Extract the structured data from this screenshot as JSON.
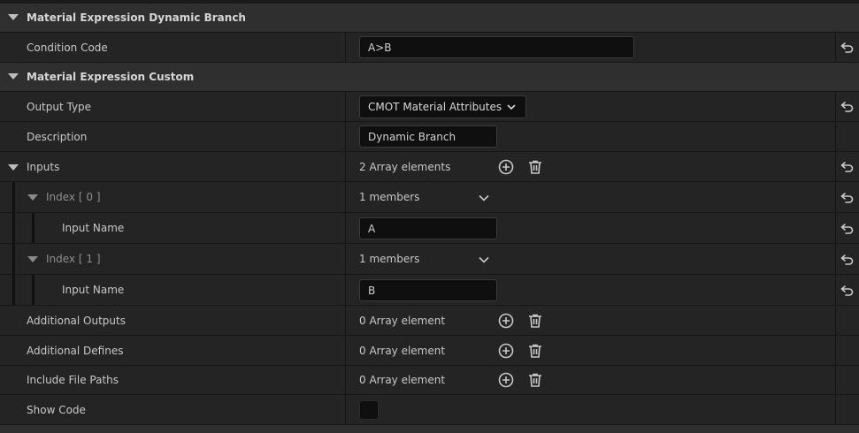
{
  "sections": {
    "dynamic_branch": {
      "title": "Material Expression Dynamic Branch"
    },
    "custom": {
      "title": "Material Expression Custom"
    }
  },
  "condition_code": {
    "label": "Condition Code",
    "value": "A>B"
  },
  "output_type": {
    "label": "Output Type",
    "value": "CMOT Material Attributes"
  },
  "description": {
    "label": "Description",
    "value": "Dynamic Branch"
  },
  "inputs": {
    "label": "Inputs",
    "count": "2 Array elements",
    "items": [
      {
        "index_label": "Index",
        "index_value": "[ 0 ]",
        "members": "1 members",
        "field_label": "Input Name",
        "field_value": "A"
      },
      {
        "index_label": "Index",
        "index_value": "[ 1 ]",
        "members": "1 members",
        "field_label": "Input Name",
        "field_value": "B"
      }
    ]
  },
  "additional_outputs": {
    "label": "Additional Outputs",
    "count": "0 Array element"
  },
  "additional_defines": {
    "label": "Additional Defines",
    "count": "0 Array element"
  },
  "include_file_paths": {
    "label": "Include File Paths",
    "count": "0 Array element"
  },
  "show_code": {
    "label": "Show Code",
    "checked": false
  },
  "icons": {
    "reset": "reset-arrow-icon",
    "add": "add-circle-icon",
    "delete": "trash-icon",
    "expand": "triangle-down-icon",
    "dropdown": "chevron-down-icon"
  }
}
